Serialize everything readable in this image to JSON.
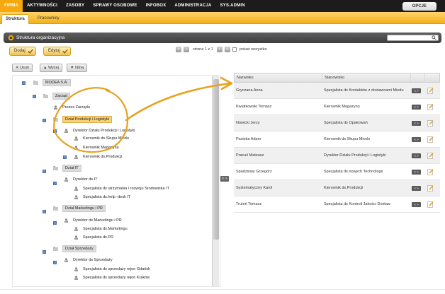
{
  "topnav": {
    "items": [
      "FIRMA",
      "AKTYWNOŚCI",
      "ZASOBY",
      "SPRAWY OSOBOWE",
      "INFOBOX",
      "ADMINISTRACJA",
      "SYS.ADMIN"
    ],
    "opcje": "OPCJE"
  },
  "subnav": {
    "tabs": [
      "Struktura",
      "Pracownicy"
    ]
  },
  "panel": {
    "title": "Struktura organizacyjna"
  },
  "toolbar": {
    "add": "Dodaj",
    "edit": "Edytuj",
    "delete": "Usuń",
    "higher": "Wyżej",
    "lower": "Niżej"
  },
  "pager": {
    "text": "strona 1 z 1",
    "first": "«",
    "prev": "‹",
    "next": "›",
    "last": "»"
  },
  "show_all": "pokaż wszystko",
  "tree": [
    "MODEA S.A.",
    "Zarząd",
    "Prezes Zarządu",
    "Dział Produkcji i Logistyki",
    "Dyrektor Działu Produkcji i Logistyki",
    "Kierownik ds.Skupu Mlodu",
    "Kierownik Magazynu",
    "Kierownik ds.Produkcji",
    "Dział IT",
    "Dyrektor ds.IT",
    "Specjalista ds utrzymania i rozwoju Srodowiska IT",
    "Specjalista ds.help -desk IT",
    "Dział Marketingu i PR",
    "Dyrektor ds.Marketingu i PR",
    "Specjalista ds.Marketingu",
    "Specjalista ds.PR",
    "Dział Sprzedaży",
    "Dyrektor ds Sprzedaży",
    "Specjalista ds sprzedaży rejon Gdańsk",
    "Specjalista ds sprzedaży rejon Kraków"
  ],
  "grid": {
    "headers": [
      "Nazwisko",
      "Stanowisko"
    ],
    "action_label": "< >",
    "rows": [
      [
        "Gryczana Anna",
        "Specjalista ds Kontaktów z dostawcami Miodu"
      ],
      [
        "Kwiatkowski Tomasz",
        "Kierownik Magazynu"
      ],
      [
        "Nowicki Jerzy",
        "Specjalista ds Opakowań"
      ],
      [
        "Pasieka Adam",
        "Kierownik ds Skupu Miodu"
      ],
      [
        "Pracuś Mateusz",
        "Dyrektor Działu Produkcji i Logistyki"
      ],
      [
        "Spadziowy Grzegorz",
        "Specjalista ds.nowych Technologii"
      ],
      [
        "Systematyczny Karol",
        "Kierownik ds.Produkcji"
      ],
      [
        "Truteń Tomasz",
        "Specjalista ds Kontroli Jakości Dostaw"
      ]
    ]
  },
  "colors": {
    "accent": "#f5a90c",
    "nav": "#1c1c1c",
    "annotation": "#e7a21d"
  }
}
